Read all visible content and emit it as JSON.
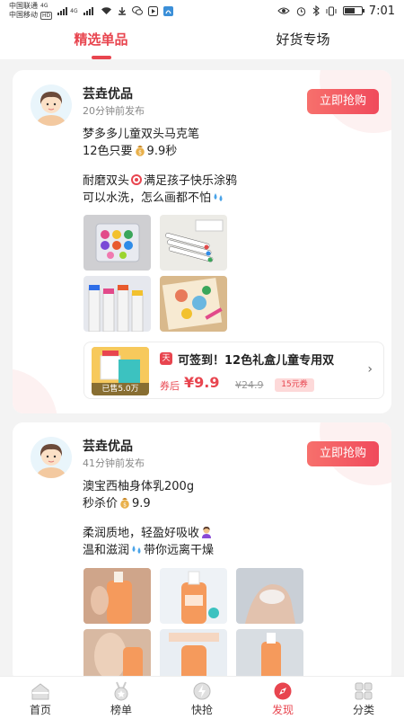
{
  "status_bar": {
    "carrier1": "中国联通",
    "carrier2": "中国移动",
    "network1": "4G",
    "network2": "4G",
    "hd": "HD",
    "time": "7:01",
    "battery_level": 0.6
  },
  "tabs": [
    {
      "label": "精选单品",
      "active": true
    },
    {
      "label": "好货专场",
      "active": false
    }
  ],
  "posts": [
    {
      "shop": "芸垚优品",
      "time_ago": "20分钟前发布",
      "buy_label": "立即抢购",
      "lines": [
        "梦多多儿童双头马克笔",
        "12色只要",
        "9.9秒",
        "耐磨双头",
        "满足孩子快乐涂鸦",
        "可以水洗，怎么画都不怕"
      ],
      "product": {
        "title": "可签到！12色礼盒儿童专用双",
        "after_coupon_label": "券后",
        "price": "¥9.9",
        "original_price": "¥24.9",
        "coupon": "15元券",
        "sold": "已售5.0万",
        "platform_icon": "tmall-icon"
      }
    },
    {
      "shop": "芸垚优品",
      "time_ago": "41分钟前发布",
      "buy_label": "立即抢购",
      "lines": [
        "澳宝西柚身体乳200g",
        "秒杀价",
        "9.9",
        "柔润质地，轻盈好吸收",
        "温和滋润",
        "带你远离干燥"
      ]
    }
  ],
  "bottom_nav": [
    {
      "label": "首页",
      "icon": "home-icon",
      "active": false
    },
    {
      "label": "榜单",
      "icon": "medal-icon",
      "active": false
    },
    {
      "label": "快抢",
      "icon": "lightning-icon",
      "active": false
    },
    {
      "label": "发现",
      "icon": "compass-icon",
      "active": true
    },
    {
      "label": "分类",
      "icon": "grid-icon",
      "active": false
    }
  ],
  "colors": {
    "accent": "#e8454f",
    "background": "#f3f3f3"
  }
}
